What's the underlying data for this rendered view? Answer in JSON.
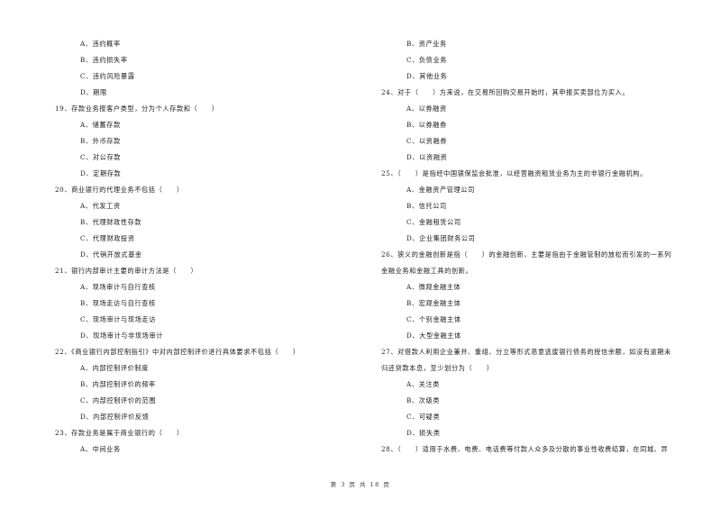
{
  "left_column": [
    {
      "type": "option",
      "text": "A、违约概率"
    },
    {
      "type": "option",
      "text": "B、违约损失率"
    },
    {
      "type": "option",
      "text": "C、违约风险暴露"
    },
    {
      "type": "option",
      "text": "D、期限"
    },
    {
      "type": "question",
      "text": "19、存款业务按客户类型，分为个人存款和（　　）"
    },
    {
      "type": "option",
      "text": "A、储蓄存款"
    },
    {
      "type": "option",
      "text": "B、外币存款"
    },
    {
      "type": "option",
      "text": "C、对公存款"
    },
    {
      "type": "option",
      "text": "D、定期存款"
    },
    {
      "type": "question",
      "text": "20、商业银行的代理业务不包括（　　）"
    },
    {
      "type": "option",
      "text": "A、代发工资"
    },
    {
      "type": "option",
      "text": "B、代理财政性存款"
    },
    {
      "type": "option",
      "text": "C、代理财政投资"
    },
    {
      "type": "option",
      "text": "D、代销开放式基金"
    },
    {
      "type": "question",
      "text": "21、银行内部审计主要的审计方法是（　　）"
    },
    {
      "type": "option",
      "text": "A、现场审计与自行查核"
    },
    {
      "type": "option",
      "text": "B、现场走访与自行查核"
    },
    {
      "type": "option",
      "text": "C、现场审计与现场走访"
    },
    {
      "type": "option",
      "text": "D、现场审计与非现场审计"
    },
    {
      "type": "question",
      "text": "22、《商业银行内部控制指引》中对内部控制评价进行具体要求不包括（　　）"
    },
    {
      "type": "option",
      "text": "A、内部控制评价制度"
    },
    {
      "type": "option",
      "text": "B、内部控制评价的频率"
    },
    {
      "type": "option",
      "text": "C、内部控制评价的范围"
    },
    {
      "type": "option",
      "text": "D、内部控制评价反馈"
    },
    {
      "type": "question",
      "text": "23、存款业务是属于商业银行的（　　）"
    },
    {
      "type": "option",
      "text": "A、中间业务"
    }
  ],
  "right_column": [
    {
      "type": "option",
      "text": "B、资产业务"
    },
    {
      "type": "option",
      "text": "C、负债业务"
    },
    {
      "type": "option",
      "text": "D、其他业务"
    },
    {
      "type": "question",
      "text": "24、对于（　　）方来说，在交易所回购交易开始时，其申报买卖部位为买入。"
    },
    {
      "type": "option",
      "text": "A、以券融资"
    },
    {
      "type": "option",
      "text": "B、以券融券"
    },
    {
      "type": "option",
      "text": "C、以资融券"
    },
    {
      "type": "option",
      "text": "D、以资融资"
    },
    {
      "type": "question",
      "text": "25、（　　）是指经中国银保监会批准，以经营融资租赁业务为主的非银行金融机构。"
    },
    {
      "type": "option",
      "text": "A、金融资产管理公司"
    },
    {
      "type": "option",
      "text": "B、信托公司"
    },
    {
      "type": "option",
      "text": "C、金融租赁公司"
    },
    {
      "type": "option",
      "text": "D、企业集团财务公司"
    },
    {
      "type": "question",
      "text": "26、狭义的金融创新是指（　　）的金融创新，主要是指由于金融管制的放松而引发的一系列"
    },
    {
      "type": "question",
      "text": "金融业务和金融工具的创新。"
    },
    {
      "type": "option",
      "text": "A、微观金融主体"
    },
    {
      "type": "option",
      "text": "B、宏观金融主体"
    },
    {
      "type": "option",
      "text": "C、个别金融主体"
    },
    {
      "type": "option",
      "text": "D、大型金融主体"
    },
    {
      "type": "question",
      "text": "27、对借款人利用企业兼并、重组、分立等形式恶意逃废银行债务的授信余额，如没有逾期未"
    },
    {
      "type": "question",
      "text": "归还贷款本息，至少划分为（　　）"
    },
    {
      "type": "option",
      "text": "A、关注类"
    },
    {
      "type": "option",
      "text": "B、次级类"
    },
    {
      "type": "option",
      "text": "C、可疑类"
    },
    {
      "type": "option",
      "text": "D、损失类"
    },
    {
      "type": "question",
      "text": "28、（　　）适用于水费、电费、电话费等付款人众多及分散的事业性收费结算，在同城、异"
    }
  ],
  "footer": {
    "page_text": "第 3 页 共 18 页"
  }
}
